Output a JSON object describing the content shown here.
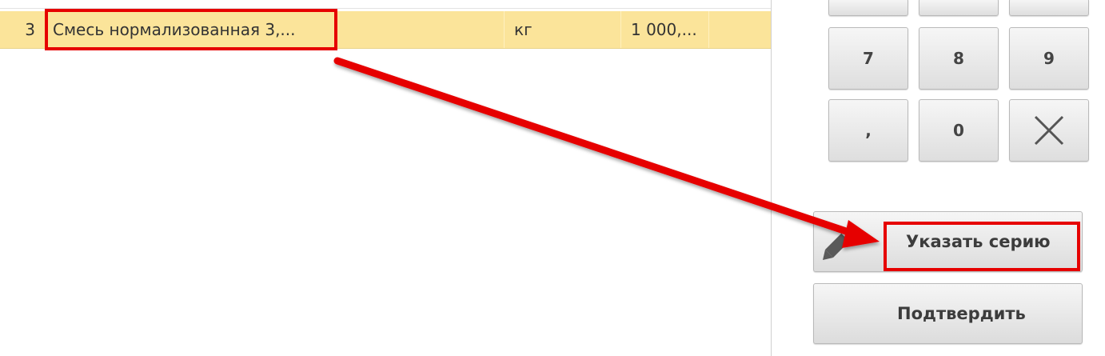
{
  "table": {
    "rows": [
      {
        "num": "3",
        "name": "Смесь нормализованная 3,...",
        "unit": "кг",
        "quantity": "1 000,..."
      }
    ]
  },
  "keypad": {
    "keys": [
      "7",
      "8",
      "9",
      ",",
      "0"
    ],
    "delete_icon": "x-icon"
  },
  "actions": {
    "specify_series": "Указать серию",
    "confirm": "Подтвердить",
    "pencil_icon": "pencil-icon"
  },
  "colors": {
    "row_highlight": "#fbe49a",
    "annotation_red": "#e60000"
  }
}
